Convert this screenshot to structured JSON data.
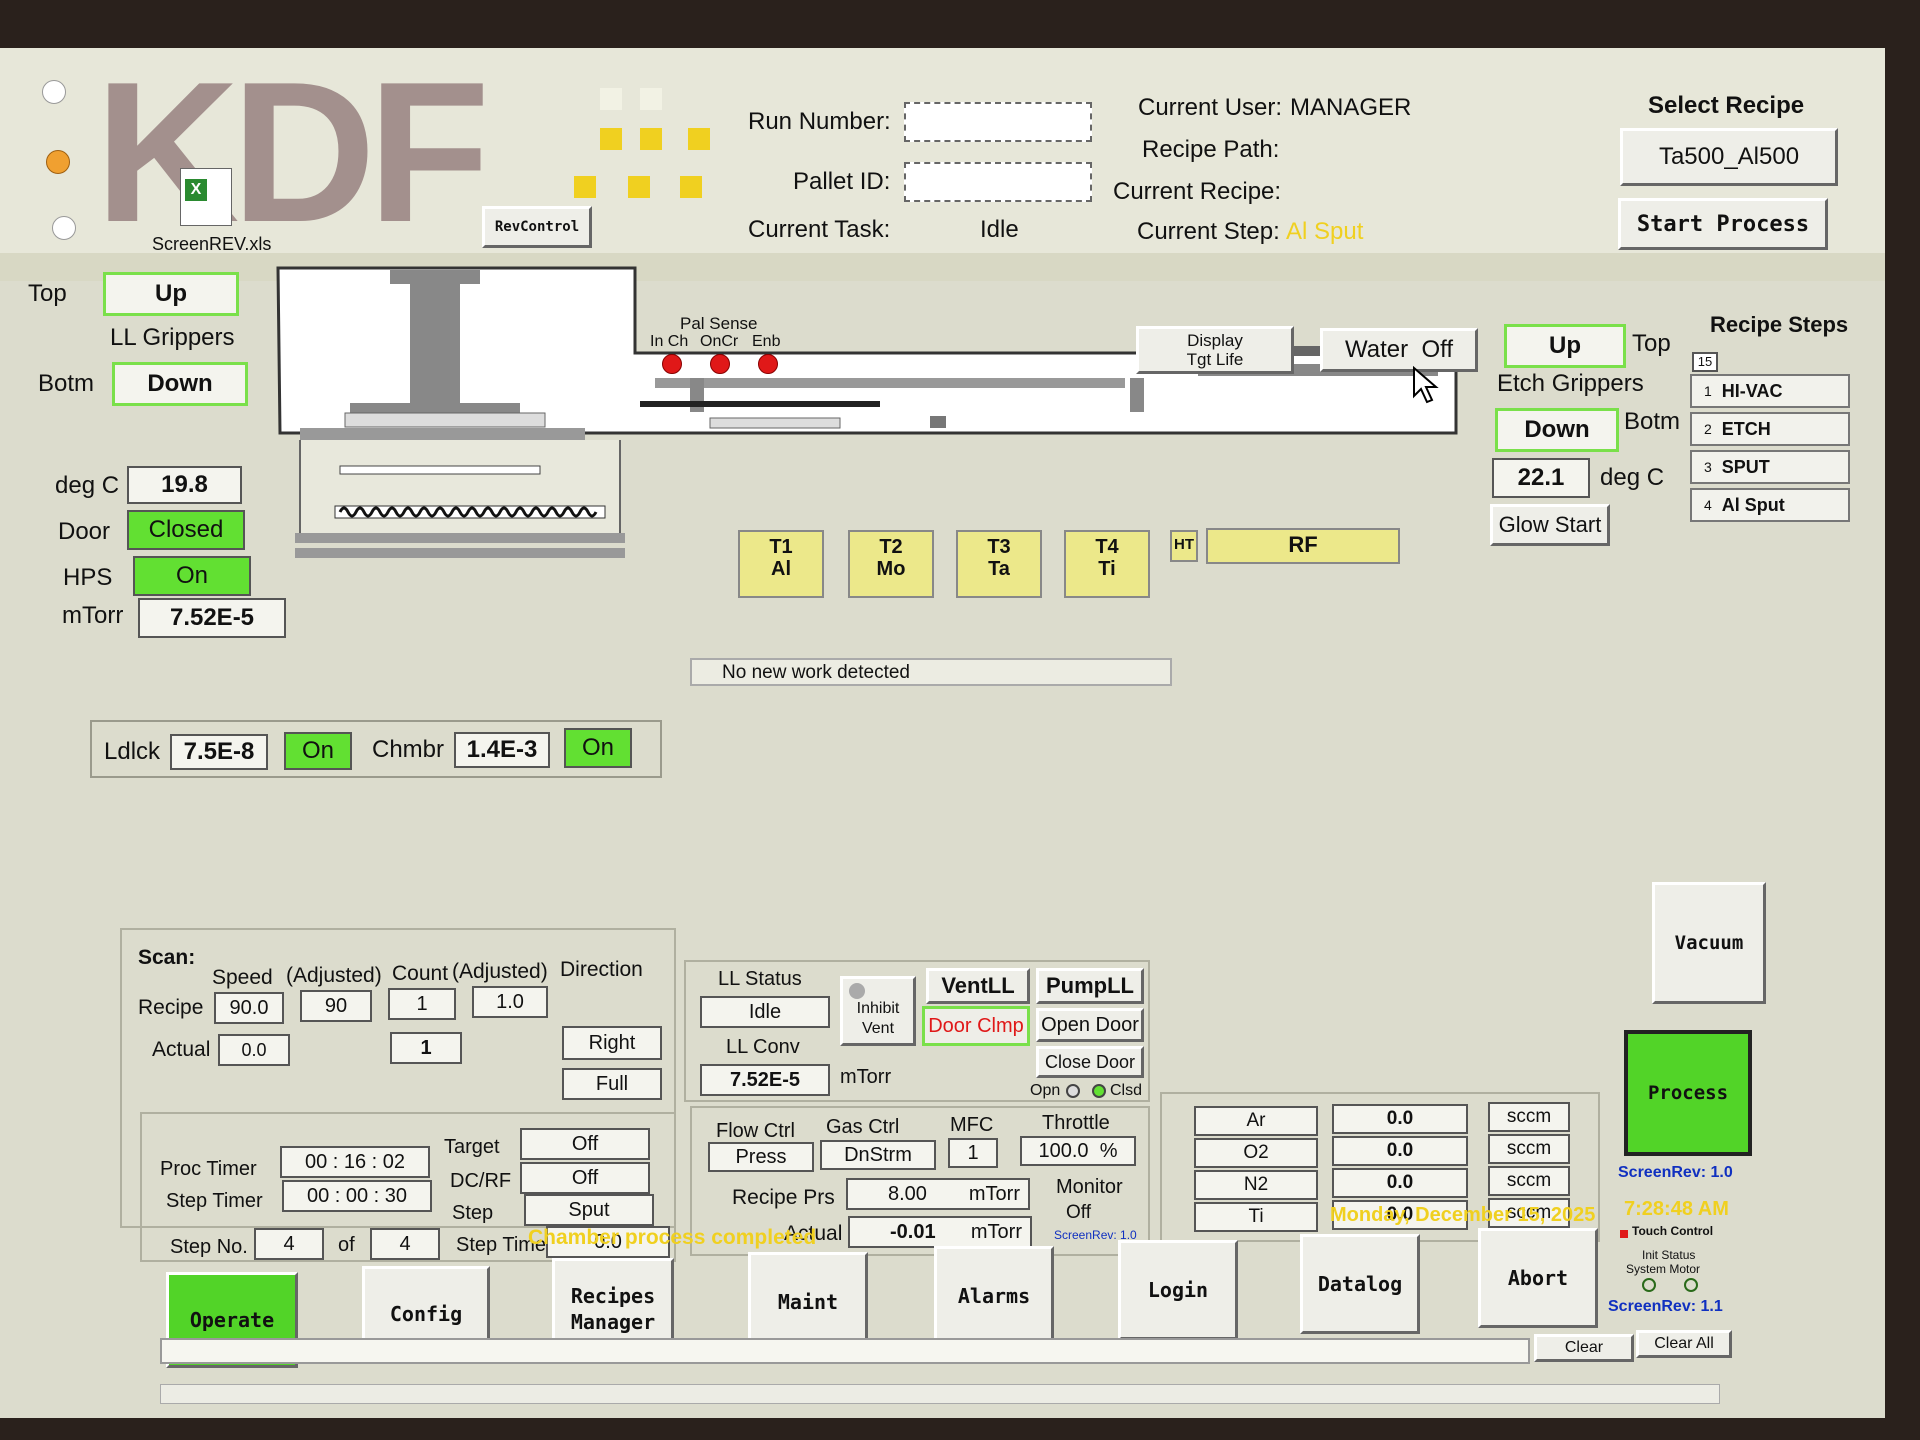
{
  "header": {
    "logo_text": "KDF",
    "file_icon_label": "ScreenREV.xls",
    "rev_control_button": "RevControl",
    "run_number_label": "Run Number:",
    "run_number_value": "",
    "pallet_id_label": "Pallet ID:",
    "pallet_id_value": "",
    "current_task_label": "Current Task:",
    "current_task_value": "Idle",
    "current_user_label": "Current User:",
    "current_user_value": "MANAGER",
    "recipe_path_label": "Recipe Path:",
    "recipe_path_value": "",
    "current_recipe_label": "Current Recipe:",
    "current_recipe_value": "",
    "current_step_label": "Current Step:",
    "current_step_value": "Al Sput",
    "select_recipe_label": "Select Recipe",
    "select_recipe_value": "Ta500_Al500",
    "start_process_button": "Start Process"
  },
  "loadlock": {
    "top_label": "Top",
    "up_button": "Up",
    "grippers_label": "LL Grippers",
    "botm_label": "Botm",
    "down_button": "Down",
    "degc_label": "deg C",
    "degc_value": "19.8",
    "door_label": "Door",
    "door_value": "Closed",
    "hps_label": "HPS",
    "hps_value": "On",
    "mtorr_label": "mTorr",
    "mtorr_value": "7.52E-5"
  },
  "chamber": {
    "pal_sense_label": "Pal Sense",
    "sense_labels": [
      "In Ch",
      "OnCr",
      "Enb"
    ],
    "display_tgt_life": [
      "Display",
      "Tgt Life"
    ],
    "water_label": "Water",
    "water_value": "Off",
    "targets": [
      {
        "id": "T1",
        "mat": "Al"
      },
      {
        "id": "T2",
        "mat": "Mo"
      },
      {
        "id": "T3",
        "mat": "Ta"
      },
      {
        "id": "T4",
        "mat": "Ti"
      }
    ],
    "ht_label": "HT",
    "rf_label": "RF",
    "message": "No new work detected"
  },
  "etch": {
    "up_button": "Up",
    "top_label": "Top",
    "grippers_label": "Etch Grippers",
    "down_button": "Down",
    "botm_label": "Botm",
    "temp_value": "22.1",
    "degc_label": "deg C",
    "glow_start_button": "Glow Start"
  },
  "recipe_steps": {
    "title": "Recipe Steps",
    "count": "15",
    "items": [
      {
        "n": "1",
        "name": "HI-VAC"
      },
      {
        "n": "2",
        "name": "ETCH"
      },
      {
        "n": "3",
        "name": "SPUT"
      },
      {
        "n": "4",
        "name": "Al Sput"
      }
    ]
  },
  "gauges": {
    "ldlck_label": "Ldlck",
    "ldlck_value": "7.5E-8",
    "ldlck_state": "On",
    "chmbr_label": "Chmbr",
    "chmbr_value": "1.4E-3",
    "chmbr_state": "On"
  },
  "scan": {
    "title": "Scan:",
    "headers": [
      "Speed",
      "(Adjusted)",
      "Count",
      "(Adjusted)",
      "Direction"
    ],
    "recipe_label": "Recipe",
    "recipe_speed": "90.0",
    "recipe_adj_speed": "90",
    "recipe_count": "1",
    "recipe_adj_count": "1.0",
    "direction": "Right",
    "actual_label": "Actual",
    "actual_speed": "0.0",
    "actual_count": "1",
    "mode": "Full"
  },
  "timers": {
    "proc_timer_label": "Proc Timer",
    "proc_timer": [
      "00",
      "16",
      "02"
    ],
    "step_timer_label": "Step Timer",
    "step_timer": [
      "00",
      "00",
      "30"
    ],
    "step_no_label": "Step No.",
    "step_no": "4",
    "of_label": "of",
    "step_total": "4",
    "target_label": "Target",
    "target_value": "Off",
    "dcrf_label": "DC/RF",
    "dcrf_value": "Off",
    "step_label": "Step",
    "step_value": "Sput",
    "step_time_label": "Step Time",
    "step_time_value": "0.0"
  },
  "ll_status": {
    "title": "LL Status",
    "status": "Idle",
    "conv_label": "LL Conv",
    "conv_value": "7.52E-5",
    "mtorr": "mTorr",
    "inhibit_vent": [
      "Inhibit",
      "Vent"
    ],
    "vent_button": "VentLL",
    "pump_button": "PumpLL",
    "door_clmp_button": "Door Clmp",
    "open_door_button": "Open Door",
    "close_door_button": "Close Door",
    "opn_label": "Opn",
    "clsd_label": "Clsd"
  },
  "flow": {
    "flow_ctrl_label": "Flow Ctrl",
    "flow_ctrl_value": "Press",
    "gas_ctrl_label": "Gas Ctrl",
    "gas_ctrl_value": "DnStrm",
    "mfc_label": "MFC",
    "mfc_value": "1",
    "throttle_label": "Throttle",
    "throttle_value": "100.0",
    "percent": "%",
    "recipe_prs_label": "Recipe Prs",
    "recipe_prs_value": "8.00",
    "actual_label": "Actual",
    "actual_value": "-0.01",
    "mtorr": "mTorr",
    "monitor_label": "Monitor",
    "monitor_value": "Off",
    "screen_rev": "ScreenRev: 1.0"
  },
  "gases": [
    {
      "name": "Ar",
      "value": "0.0",
      "unit": "sccm"
    },
    {
      "name": "O2",
      "value": "0.0",
      "unit": "sccm"
    },
    {
      "name": "N2",
      "value": "0.0",
      "unit": "sccm"
    },
    {
      "name": "Ti",
      "value": "0.0",
      "unit": "sccm"
    }
  ],
  "right_panel": {
    "vacuum_button": "Vacuum",
    "process_button": "Process",
    "screen_rev_top": "ScreenRev: 1.0",
    "time": "7:28:48 AM",
    "date": "Monday, December 15, 2025",
    "touch_control": "Touch Control",
    "init_status": "Init Status",
    "system_motor": "System Motor",
    "screen_rev_bottom": "ScreenRev: 1.1"
  },
  "footer": {
    "status_message": "Chamber process completed",
    "buttons": [
      "Operate",
      "Config",
      "Recipes Manager",
      "Maint",
      "Alarms",
      "Login",
      "Datalog",
      "Abort"
    ],
    "clear": "Clear",
    "clear_all": "Clear All"
  },
  "colors": {
    "active_green": "#62e032",
    "target_yellow": "#ece88a",
    "highlight_yellow": "#f0d020",
    "alarm_red": "#e01818",
    "rev_blue": "#1030c0"
  }
}
